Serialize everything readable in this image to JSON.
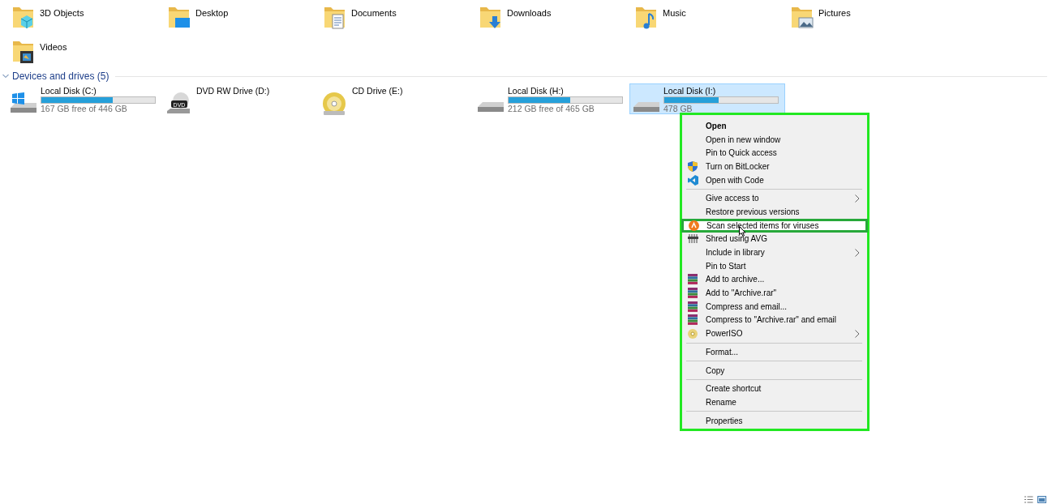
{
  "folders": [
    {
      "name": "3D Objects",
      "kind": "cube"
    },
    {
      "name": "Desktop",
      "kind": "desktop"
    },
    {
      "name": "Documents",
      "kind": "document"
    },
    {
      "name": "Downloads",
      "kind": "download"
    },
    {
      "name": "Music",
      "kind": "music"
    },
    {
      "name": "Pictures",
      "kind": "pictures"
    },
    {
      "name": "Videos",
      "kind": "video"
    }
  ],
  "drives_section": {
    "title": "Devices and drives (5)",
    "expanded": true
  },
  "drives": [
    {
      "name": "Local Disk (C:)",
      "kind": "windows-disk",
      "level": 0.63,
      "space": "167 GB free of 446 GB",
      "selected": false
    },
    {
      "name": "DVD RW Drive (D:)",
      "kind": "dvd",
      "icon_text": "DVD",
      "selected": false
    },
    {
      "name": "CD Drive (E:)",
      "kind": "cd",
      "selected": false
    },
    {
      "name": "Local Disk (H:)",
      "kind": "disk",
      "level": 0.54,
      "space": "212 GB free of 465 GB",
      "selected": false
    },
    {
      "name": "Local Disk (I:)",
      "kind": "disk",
      "level": 0.48,
      "space": "478 GB",
      "selected": true
    }
  ],
  "context_menu": [
    {
      "kind": "plain",
      "label": "Open",
      "bold": true
    },
    {
      "kind": "plain",
      "label": "Open in new window"
    },
    {
      "kind": "plain",
      "label": "Pin to Quick access"
    },
    {
      "kind": "shield",
      "label": "Turn on BitLocker"
    },
    {
      "kind": "code",
      "label": "Open with Code"
    },
    {
      "kind": "separator"
    },
    {
      "kind": "plain",
      "label": "Give access to",
      "submenu": true
    },
    {
      "kind": "plain",
      "label": "Restore previous versions"
    },
    {
      "kind": "scan",
      "label": "Scan selected items for viruses",
      "highlighted": true
    },
    {
      "kind": "shred",
      "label": "Shred using AVG"
    },
    {
      "kind": "plain",
      "label": "Include in library",
      "submenu": true
    },
    {
      "kind": "plain",
      "label": "Pin to Start"
    },
    {
      "kind": "archive",
      "label": "Add to archive..."
    },
    {
      "kind": "archive",
      "label": "Add to \"Archive.rar\""
    },
    {
      "kind": "archive",
      "label": "Compress and email..."
    },
    {
      "kind": "archive",
      "label": "Compress to \"Archive.rar\" and email"
    },
    {
      "kind": "disc",
      "label": "PowerISO",
      "submenu": true
    },
    {
      "kind": "separator"
    },
    {
      "kind": "plain",
      "label": "Format..."
    },
    {
      "kind": "separator"
    },
    {
      "kind": "plain",
      "label": "Copy"
    },
    {
      "kind": "separator"
    },
    {
      "kind": "plain",
      "label": "Create shortcut"
    },
    {
      "kind": "plain",
      "label": "Rename"
    },
    {
      "kind": "separator"
    },
    {
      "kind": "plain",
      "label": "Properties"
    }
  ]
}
